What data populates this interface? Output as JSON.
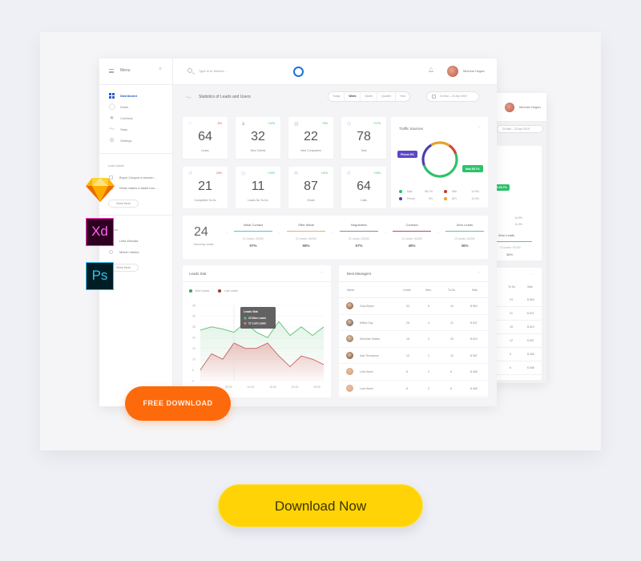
{
  "topbar": {
    "menu_label": "Menu",
    "search_placeholder": "Type in to Search...",
    "user_name": "Micheal Hogan"
  },
  "sidebar": {
    "items": [
      {
        "label": "Dashboard",
        "icon": "dashboard-icon",
        "active": true
      },
      {
        "label": "Deals",
        "icon": "user-circle-icon"
      },
      {
        "label": "Contacts",
        "icon": "star-icon"
      },
      {
        "label": "Stats",
        "icon": "trend-icon"
      },
      {
        "label": "Settings",
        "icon": "gear-icon"
      }
    ],
    "last_leads_title": "Last Leads",
    "last_leads": [
      "Bryce Canyon a stunnin...",
      "What makes a fastel bou..."
    ],
    "show_more_label": "Show More",
    "clients_title": "Clients",
    "clients": [
      "Leila Estrada",
      "Melvin Valdez"
    ]
  },
  "header": {
    "title": "Statistics of Leads and Users",
    "periods": [
      "Today",
      "Week",
      "Month",
      "Quarter",
      "Year"
    ],
    "active_period": "Week",
    "date_range": "24 Mar – 23 Apr 2019"
  },
  "stats": [
    {
      "value": "64",
      "label": "Leads",
      "change": "-5%",
      "trend": "down",
      "icon": "briefcase-icon"
    },
    {
      "value": "32",
      "label": "New Clients",
      "change": "+12%",
      "trend": "up",
      "icon": "user-icon"
    },
    {
      "value": "22",
      "label": "New Companies",
      "change": "+5%",
      "trend": "up",
      "icon": "building-icon"
    },
    {
      "value": "78",
      "label": "Task",
      "change": "+17%",
      "trend": "up",
      "icon": "clock-icon"
    },
    {
      "value": "21",
      "label": "Completed To-Do",
      "change": "-25%",
      "trend": "down",
      "icon": "history-icon"
    },
    {
      "value": "11",
      "label": "Leads No To-Do",
      "change": "+10%",
      "trend": "up",
      "icon": "clock-icon"
    },
    {
      "value": "87",
      "label": "Email",
      "change": "+11%",
      "trend": "up",
      "icon": "mail-icon"
    },
    {
      "value": "64",
      "label": "Calls",
      "change": "+15%",
      "trend": "up",
      "icon": "phone-icon"
    }
  ],
  "traffic": {
    "title": "Traffic Sources",
    "tooltip_phone": "Phone 9%",
    "tooltip_mail": "Mail 85.7%",
    "legend": [
      {
        "label": "Mail",
        "value": "85.7%",
        "color": "#2ec26a"
      },
      {
        "label": "Site",
        "value": "14.9%",
        "color": "#c0392b"
      },
      {
        "label": "Phone",
        "value": "9%",
        "color": "#4b3fb0"
      },
      {
        "label": "API",
        "value": "11.9%",
        "color": "#e8a22a"
      }
    ],
    "segments": [
      {
        "name": "Mail",
        "fraction": 0.5,
        "color": "#2ec26a"
      },
      {
        "name": "Phone",
        "fraction": 0.22,
        "color": "#4b3fb0"
      },
      {
        "name": "API",
        "fraction": 0.18,
        "color": "#e8a22a"
      },
      {
        "name": "Site",
        "fraction": 0.1,
        "color": "#d0453a"
      }
    ]
  },
  "funnel": {
    "incoming_value": "24",
    "incoming_label": "Incoming Leads",
    "stages": [
      {
        "title": "Initial Contact",
        "meta": "21 Leads • $1250",
        "percent": "97%",
        "color": "#4fc3d9"
      },
      {
        "title": "Offer Made",
        "meta": "22 Leads • $1250",
        "percent": "68%",
        "color": "#d8b66a"
      },
      {
        "title": "Negotiation",
        "meta": "21 Leads • $1250",
        "percent": "57%",
        "color": "#9b7fb0"
      },
      {
        "title": "Contract",
        "meta": "13 Leads • $1250",
        "percent": "48%",
        "color": "#b84a64"
      },
      {
        "title": "Won Leads",
        "meta": "13 Leads • $1250",
        "percent": "36%",
        "color": "#5cc6a0"
      }
    ]
  },
  "leads_stat": {
    "title": "Leads Stat",
    "legend_won": "Won Leads",
    "legend_lost": "Lost Leads",
    "tooltip_title": "Leads Stat",
    "tooltip_won": "23 Won Leads",
    "tooltip_lost": "17 Lost Leads"
  },
  "chart_data": {
    "type": "area",
    "title": "Leads Stat",
    "xlabel": "",
    "ylabel": "",
    "ylim": [
      0,
      35
    ],
    "yticks": [
      0,
      5,
      10,
      15,
      20,
      25,
      30,
      35
    ],
    "xticks": [
      "05:00",
      "10:00",
      "15:00",
      "20:00",
      "25:00"
    ],
    "x": [
      0,
      1,
      2,
      3,
      4,
      5,
      6,
      7,
      8,
      9,
      10,
      11
    ],
    "series": [
      {
        "name": "Won Leads",
        "color": "#5cbf7a",
        "values": [
          23.5,
          25,
          24,
          22.5,
          27,
          22.5,
          20,
          27.5,
          21,
          25,
          21,
          25
        ]
      },
      {
        "name": "Lost Leads",
        "color": "#c46060",
        "values": [
          5,
          12.5,
          10,
          17.5,
          15,
          15,
          17.5,
          11.5,
          6.5,
          11.5,
          10,
          7.5
        ]
      }
    ],
    "legend": "top-left",
    "grid": true
  },
  "managers": {
    "title": "Best Managers",
    "columns": [
      "Name",
      "Leads",
      "Won",
      "To Do",
      "Sale"
    ],
    "rows": [
      {
        "name": "Gary Bryan",
        "leads": "33",
        "won": "5",
        "todo": "24",
        "sale": "$ 564"
      },
      {
        "name": "Milton Day",
        "leads": "25",
        "won": "4",
        "todo": "21",
        "sale": "$ 647"
      },
      {
        "name": "Nicholas Stokes",
        "leads": "15",
        "won": "2",
        "todo": "15",
        "sale": "$ 610"
      },
      {
        "name": "Ada Thompson",
        "leads": "12",
        "won": "1",
        "todo": "12",
        "sale": "$ 567"
      },
      {
        "name": "Lela Harris",
        "leads": "8",
        "won": "2",
        "todo": "6",
        "sale": "$ 465"
      },
      {
        "name": "Lela Harris",
        "leads": "8",
        "won": "2",
        "todo": "6",
        "sale": "$ 465"
      }
    ]
  },
  "ghost": {
    "user_name": "Michael Hogan",
    "date_range": "24 Mar – 23 Apr 2019",
    "tag": "Mail 85.7%",
    "legend": [
      {
        "label": "Site",
        "value": "14.9%",
        "color": "#c0392b"
      },
      {
        "label": "API",
        "value": "11.9%",
        "color": "#e8a22a"
      }
    ],
    "stage_title": "Won Leads",
    "stage_meta": "13 Leads • $1250",
    "stage_percent": "36%",
    "columns": [
      "To Do",
      "Sale"
    ],
    "rows": [
      [
        "24",
        "$ 564"
      ],
      [
        "21",
        "$ 647"
      ],
      [
        "15",
        "$ 610"
      ],
      [
        "12",
        "$ 567"
      ],
      [
        "6",
        "$ 465"
      ],
      [
        "6",
        "$ 465"
      ]
    ]
  },
  "app_icons": [
    "Sketch",
    "Xd",
    "Ps"
  ],
  "cta": {
    "free_download": "FREE DOWNLOAD",
    "download_now": "Download Now"
  }
}
